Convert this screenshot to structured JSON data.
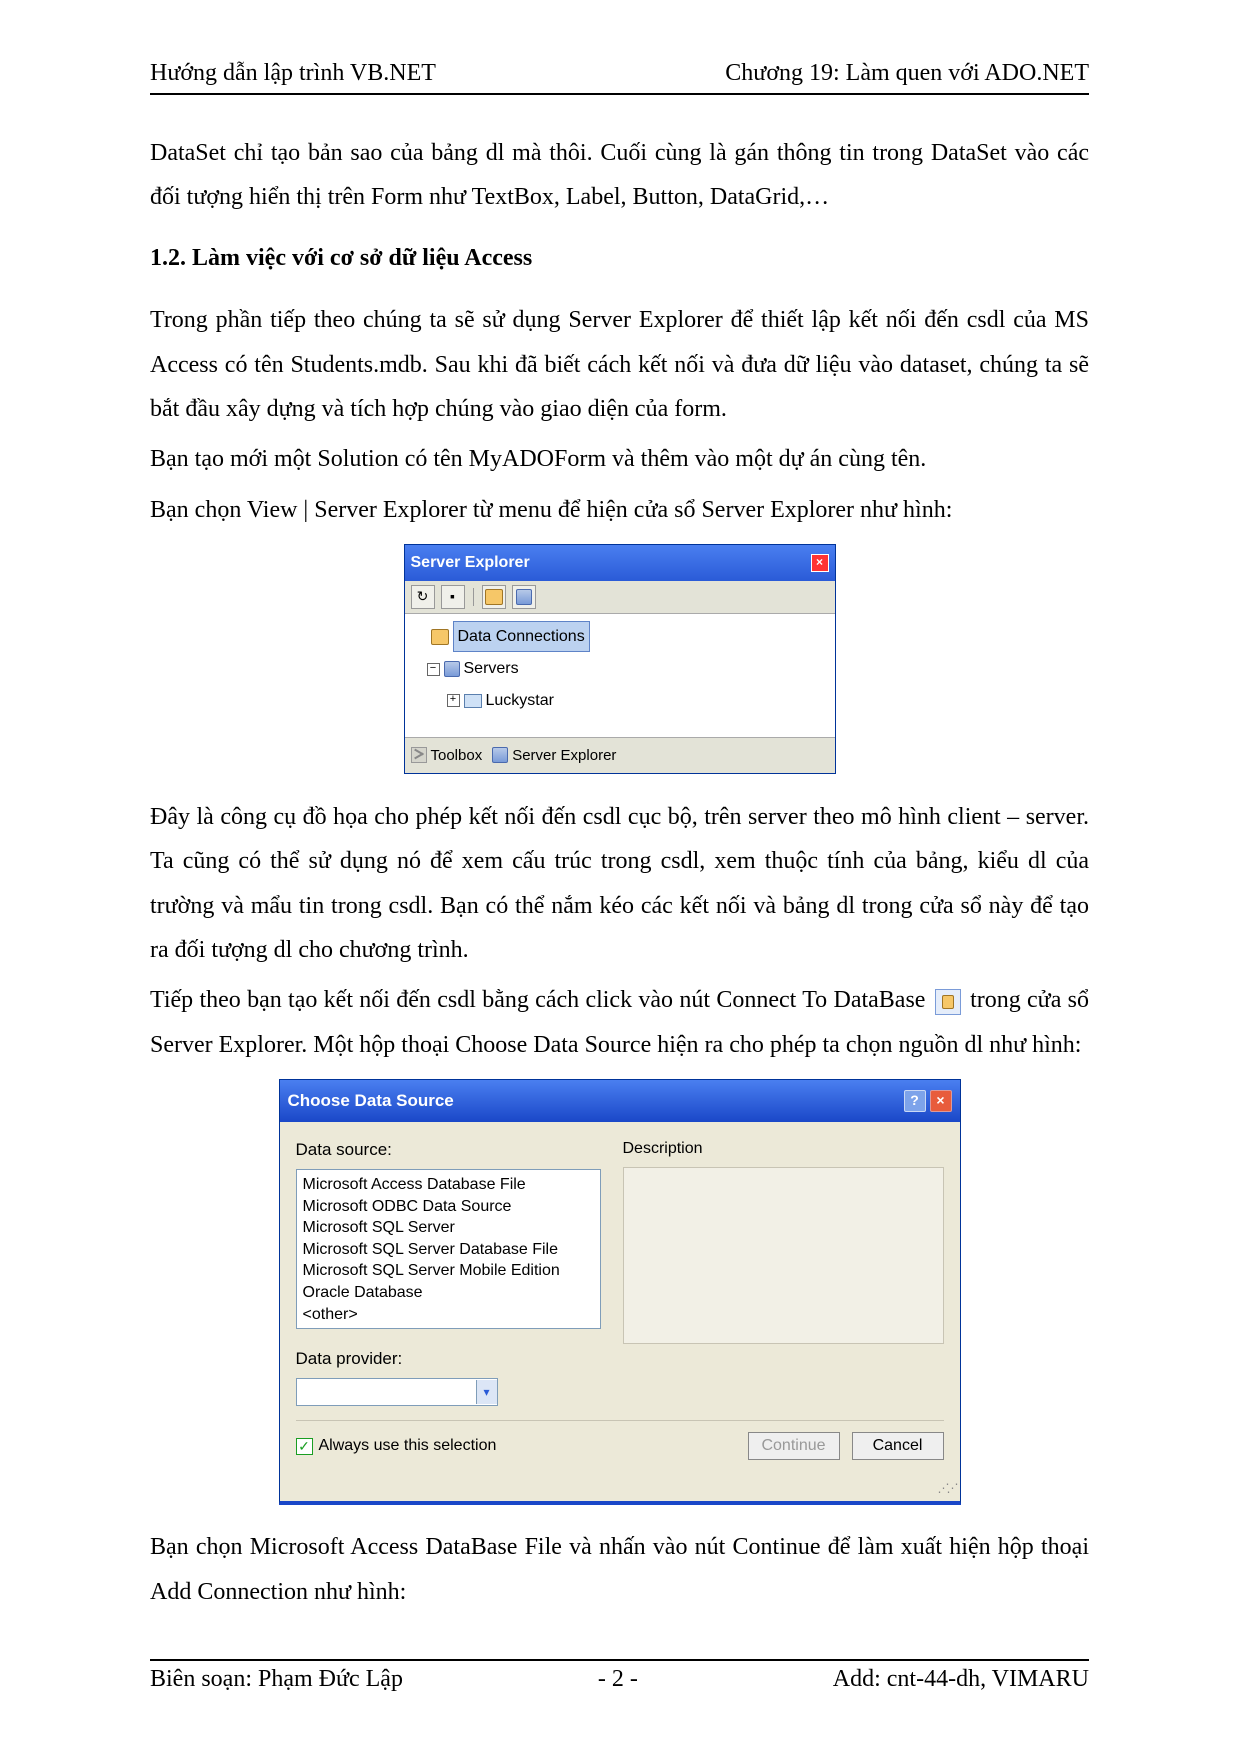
{
  "header": {
    "left": "Hướng dẫn lập trình VB.NET",
    "right": "Chương 19: Làm quen với ADO.NET"
  },
  "paragraphs": {
    "p1": "DataSet chỉ tạo bản sao của bảng dl mà thôi. Cuối cùng là gán thông tin trong DataSet vào các đối tượng hiển thị trên Form như TextBox, Label, Button, DataGrid,…",
    "h1": "1.2. Làm việc với cơ sở dữ liệu Access",
    "p2": "Trong phần tiếp theo chúng ta sẽ sử dụng Server Explorer để thiết lập kết nối đến csdl của MS Access có tên Students.mdb. Sau khi đã biết cách kết nối và đưa dữ liệu vào dataset, chúng ta sẽ bắt đầu xây dựng và tích hợp chúng vào giao diện của form.",
    "p3": "Bạn tạo mới một Solution có tên MyADOForm và thêm vào một dự án cùng tên.",
    "p4": "Bạn chọn View | Server Explorer từ menu để hiện cửa sổ Server Explorer như hình:",
    "p5": "Đây là công cụ đồ họa cho phép kết nối đến csdl cục bộ, trên server theo mô hình client – server. Ta cũng có thể sử dụng nó để xem cấu trúc trong csdl, xem thuộc tính của bảng, kiểu dl của trường và mẩu tin trong csdl. Bạn có thể nắm kéo các kết nối và bảng dl trong cửa sổ này để tạo ra đối tượng dl cho chương trình.",
    "p6a": "Tiếp theo bạn tạo kết nối đến csdl bằng cách click vào nút Connect To DataBase ",
    "p6b": " trong cửa sổ Server Explorer. Một hộp thoại Choose Data Source hiện ra cho phép ta chọn nguồn dl như hình:",
    "p7": "Bạn chọn Microsoft Access DataBase File và nhấn vào nút Continue để làm xuất hiện hộp thoại Add Connection như hình:"
  },
  "serverExplorer": {
    "title": "Server Explorer",
    "nodes": {
      "dataConnections": "Data Connections",
      "servers": "Servers",
      "server1": "Luckystar"
    },
    "tabs": {
      "toolbox": "Toolbox",
      "serverExplorer": "Server Explorer"
    }
  },
  "chooseDataSource": {
    "title": "Choose Data Source",
    "labels": {
      "dataSource": "Data source:",
      "description": "Description",
      "dataProvider": "Data provider:",
      "always": "Always use this selection"
    },
    "sources": [
      "Microsoft Access Database File",
      "Microsoft ODBC Data Source",
      "Microsoft SQL Server",
      "Microsoft SQL Server Database File",
      "Microsoft SQL Server Mobile Edition",
      "Oracle Database",
      "<other>"
    ],
    "buttons": {
      "continue": "Continue",
      "cancel": "Cancel"
    }
  },
  "footer": {
    "left": "Biên soạn: Phạm Đức Lập",
    "center": "- 2 -",
    "right": "Add: cnt-44-dh, VIMARU"
  }
}
